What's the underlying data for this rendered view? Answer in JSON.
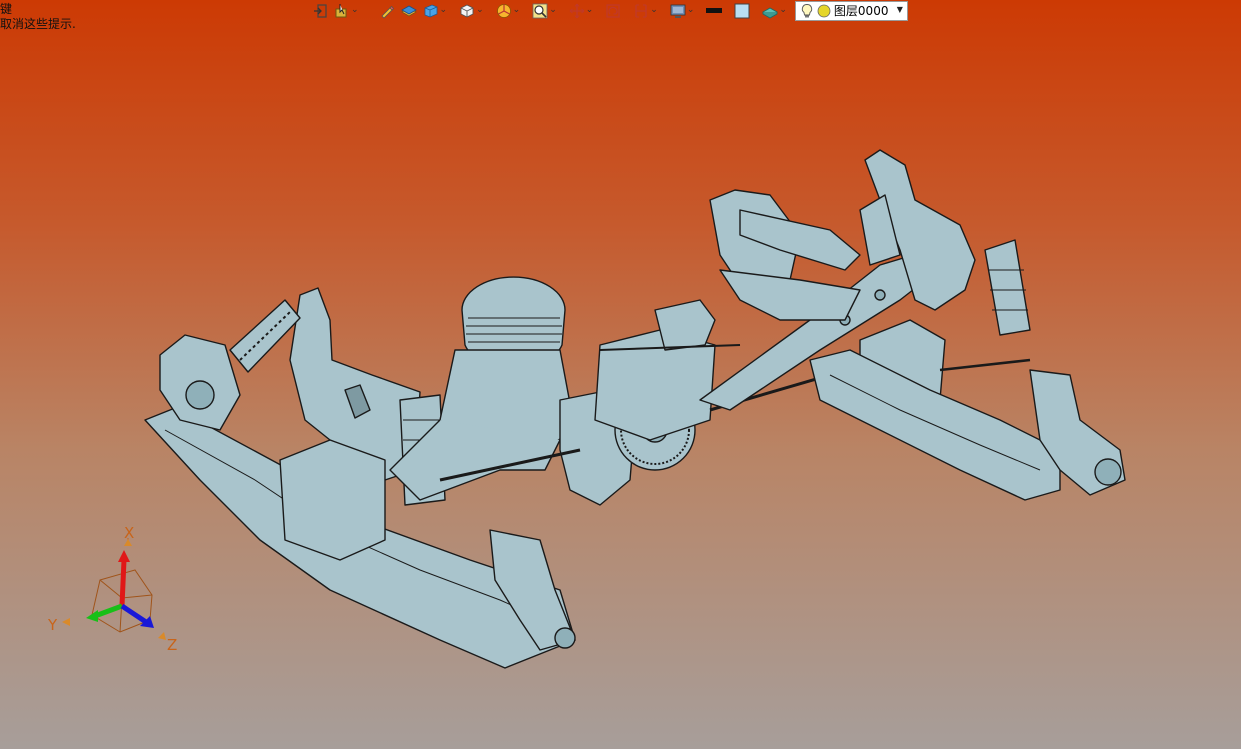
{
  "hint": {
    "line1": "键",
    "line2": "取消这些提示."
  },
  "toolbar": {
    "layer_label": "图层0000",
    "buttons": [
      {
        "icon": "exit-sketch-icon"
      },
      {
        "icon": "select-filter-icon"
      },
      {
        "icon": "pencil-icon"
      },
      {
        "icon": "layer-icon"
      },
      {
        "icon": "box-view-icon"
      },
      {
        "icon": "cube-icon"
      },
      {
        "icon": "render-mode-icon"
      },
      {
        "icon": "zoom-icon"
      },
      {
        "icon": "pan-icon"
      },
      {
        "icon": "rotate-view-icon"
      },
      {
        "icon": "section-icon"
      },
      {
        "icon": "display-icon"
      },
      {
        "icon": "line-color-icon"
      },
      {
        "icon": "face-color-icon"
      },
      {
        "icon": "surface-icon"
      }
    ]
  },
  "triad": {
    "x_label": "X",
    "y_label": "Y",
    "z_label": "Z",
    "x_color": "#e01818",
    "y_color": "#18c018",
    "z_color": "#1818d8"
  },
  "model": {
    "part_color": "#a9c4cc",
    "edge_color": "#1a1a1a"
  }
}
